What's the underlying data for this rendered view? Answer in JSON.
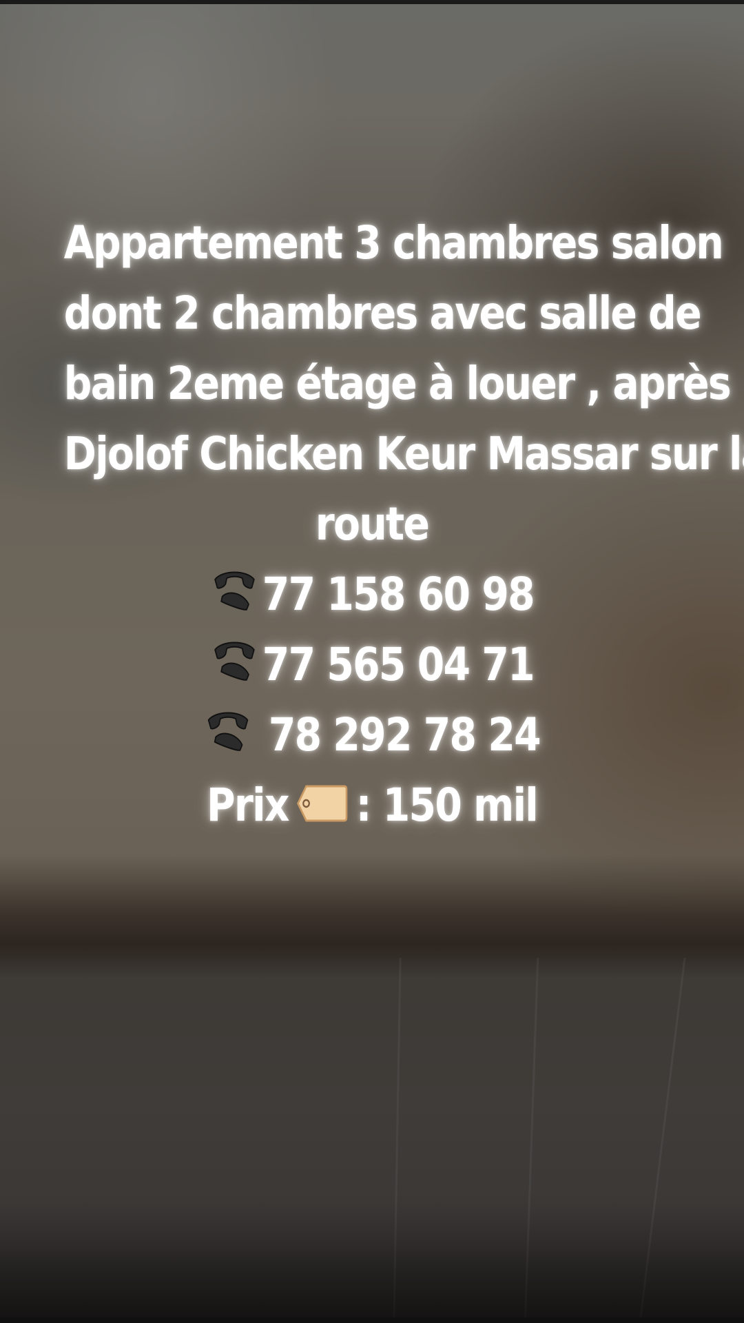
{
  "post": {
    "description_lines": [
      "Appartement 3 chambres salon",
      "dont 2 chambres avec salle de",
      "bain 2eme étage à louer , après",
      "Djolof Chicken Keur Massar sur la",
      "route"
    ],
    "phones": [
      {
        "icon": "telephone-icon",
        "number": "77 158 60 98"
      },
      {
        "icon": "telephone-icon",
        "number": "77 565 04 71"
      },
      {
        "icon": "telephone-icon",
        "number": " 78 292 78 24"
      }
    ],
    "price": {
      "label": "Prix",
      "icon": "price-tag-icon",
      "value": ": 150 mil"
    }
  },
  "colors": {
    "text": "#ffffff",
    "glow": "#ffffff",
    "tag_fill": "#f2d3a6",
    "tag_edge": "#c99a63",
    "phone_icon": "#2b2b2b"
  }
}
